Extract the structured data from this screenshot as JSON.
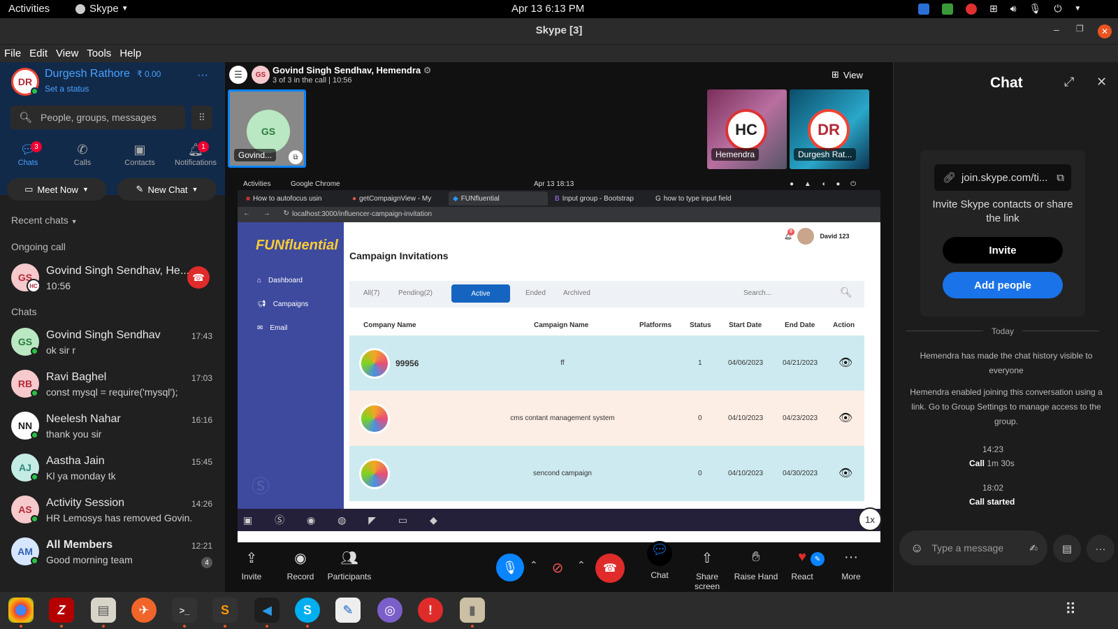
{
  "system": {
    "activities": "Activities",
    "app": "Skype",
    "datetime": "Apr 13  6:13 PM"
  },
  "window": {
    "title": "Skype [3]"
  },
  "menu": [
    "File",
    "Edit",
    "View",
    "Tools",
    "Help"
  ],
  "profile": {
    "initials": "DR",
    "name": "Durgesh Rathore",
    "balance": "₹ 0.00",
    "status": "Set a status"
  },
  "search": {
    "placeholder": "People, groups, messages"
  },
  "nav": [
    {
      "label": "Chats",
      "badge": "3"
    },
    {
      "label": "Calls"
    },
    {
      "label": "Contacts"
    },
    {
      "label": "Notifications",
      "badge": "1"
    }
  ],
  "actions": {
    "meet_now": "Meet Now",
    "new_chat": "New Chat"
  },
  "recent_chats": "Recent chats",
  "ongoing_call": {
    "header": "Ongoing call",
    "name": "Govind Singh Sendhav, He...",
    "time": "10:56",
    "initials": "GS",
    "sub": "HC"
  },
  "chats_header": "Chats",
  "chats": [
    {
      "initials": "GS",
      "name": "Govind Singh Sendhav",
      "msg": "ok sir r",
      "time": "17:43",
      "color": "#b9e8c3",
      "fg": "#2d7a3c"
    },
    {
      "initials": "RB",
      "name": "Ravi Baghel",
      "msg": "const mysql = require('mysql');",
      "time": "17:03",
      "color": "#f6c9cc",
      "fg": "#b02a37"
    },
    {
      "initials": "NN",
      "name": "Neelesh Nahar",
      "msg": "thank you sir",
      "time": "16:16",
      "color": "#ffffff",
      "fg": "#222"
    },
    {
      "initials": "AJ",
      "name": "Aastha Jain",
      "msg": "Kl ya monday tk",
      "time": "15:45",
      "color": "#c5ebe5",
      "fg": "#2a8a7a"
    },
    {
      "initials": "AS",
      "name": "Activity Session",
      "msg": "HR Lemosys has removed Govin...",
      "time": "14:26",
      "color": "#f6c9cc",
      "fg": "#b02a37"
    },
    {
      "initials": "AM",
      "name": "All Members",
      "msg": "Good morning team",
      "time": "12:21",
      "badge": "4",
      "color": "#d6e6ff",
      "fg": "#3060b0"
    }
  ],
  "call": {
    "initials": "GS",
    "title": "Govind Singh Sendhav, Hemendra",
    "subtitle": "3 of 3 in the call | 10:56",
    "view": "View"
  },
  "participants": [
    {
      "initials": "GS",
      "name": "Govind..."
    },
    {
      "initials": "HC",
      "name": "Hemendra"
    },
    {
      "initials": "DR",
      "name": "Durgesh Rat..."
    }
  ],
  "shared": {
    "topbar": {
      "activities": "Activities",
      "app": "Google Chrome",
      "datetime": "Apr 13  18:13"
    },
    "tabs": [
      "How to autofocus usin",
      "getCompaignView - My",
      "FUNfluential",
      "Input group - Bootstrap",
      "how to type input field"
    ],
    "url": "localhost:3000/influencer-campaign-invitation",
    "logo": "FUNfluential",
    "sidebar": [
      "Dashboard",
      "Campaigns",
      "Email"
    ],
    "user": "David 123",
    "bell_count": "0",
    "page_title": "Campaign Invitations",
    "filters": [
      "All(7)",
      "Pending(2)",
      "Active",
      "Ended",
      "Archived"
    ],
    "search_placeholder": "Search...",
    "columns": [
      "Company Name",
      "Campaign Name",
      "Platforms",
      "Status",
      "Start Date",
      "End Date",
      "Action"
    ],
    "rows": [
      {
        "company": "99956",
        "campaign": "ff",
        "platforms": "",
        "status": "1",
        "start": "04/06/2023",
        "end": "04/21/2023",
        "bg": "#cdeaf0"
      },
      {
        "company": "",
        "campaign": "cms contant management system",
        "platforms": "",
        "status": "0",
        "start": "04/10/2023",
        "end": "04/23/2023",
        "bg": "#fdeee5"
      },
      {
        "company": "",
        "campaign": "sencond campaign",
        "platforms": "",
        "status": "0",
        "start": "04/10/2023",
        "end": "04/30/2023",
        "bg": "#cdeaf0"
      }
    ],
    "zoom": "1x"
  },
  "controls": [
    {
      "label": "Invite"
    },
    {
      "label": "Record"
    },
    {
      "label": "Participants"
    },
    {
      "label": "Chat"
    },
    {
      "label": "Share screen"
    },
    {
      "label": "Raise Hand"
    },
    {
      "label": "React"
    },
    {
      "label": "More"
    }
  ],
  "right": {
    "title": "Chat",
    "link": "join.skype.com/ti...",
    "invite_text": "Invite Skype contacts or share the link",
    "invite_btn": "Invite",
    "add_btn": "Add people",
    "today": "Today",
    "msg1": "Hemendra has made the chat history visible to everyone",
    "msg2": "Hemendra enabled joining this conversation using a link. Go to Group Settings to manage access to the group.",
    "t1": "14:23",
    "call1": "Call",
    "call1_dur": "1m 30s",
    "t2": "18:02",
    "call2": "Call started",
    "input_placeholder": "Type a message"
  }
}
